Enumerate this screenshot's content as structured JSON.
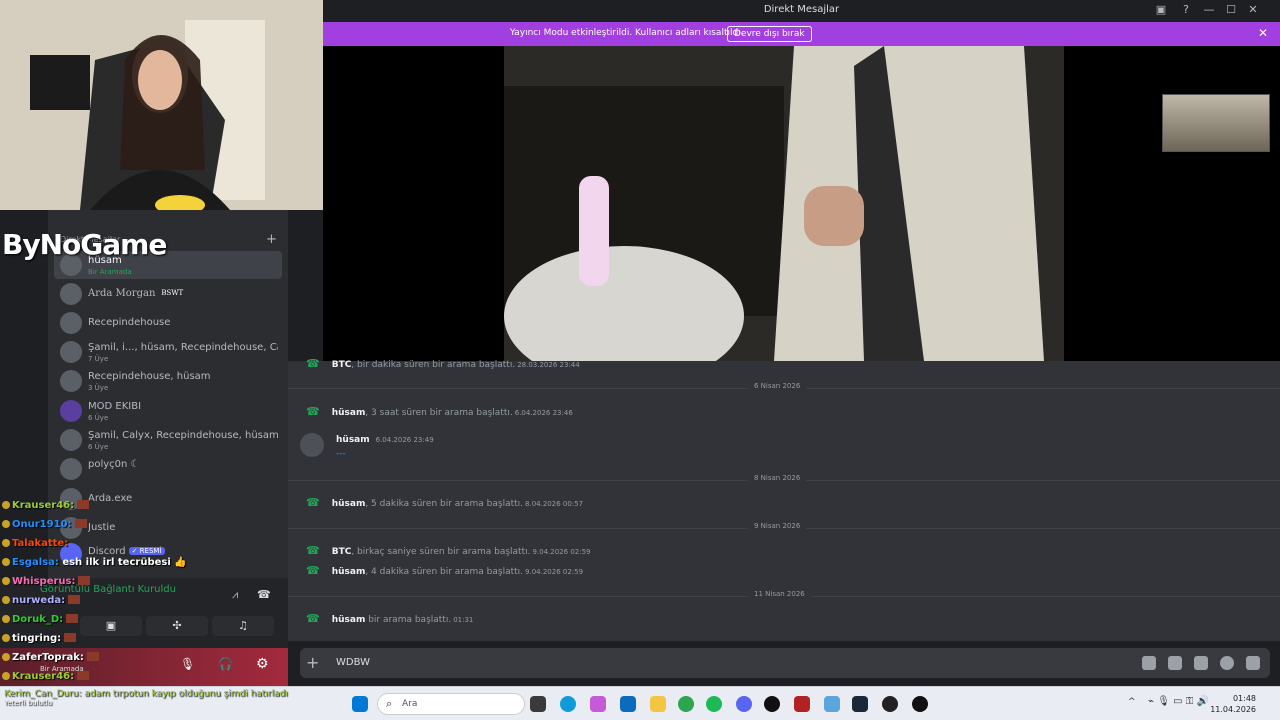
{
  "window": {
    "title": "Direkt Mesajlar",
    "controls": [
      "—",
      "☐",
      "✕"
    ]
  },
  "banner": {
    "message": "Yayıncı Modu etkinleştirildi. Kullanıcı adları kısaltıldı.",
    "button": "Devre dışı bırak"
  },
  "overlay": {
    "logo": "ByNoGame"
  },
  "sidebar": {
    "header": "Direkt Mesajlar",
    "add": "+",
    "dms": [
      {
        "name": "hüsam",
        "sub": "Bir Aramada",
        "active": true
      },
      {
        "name": "Arda Morgan",
        "tag": "BSWT"
      },
      {
        "name": "Recepindehouse",
        "sub": ""
      },
      {
        "name": "Şamil, i..., hüsam, Recepindehouse, Calyx...",
        "sub": "7 Üye"
      },
      {
        "name": "Recepindehouse, hüsam",
        "sub": "3 Üye"
      },
      {
        "name": "MOD EKİBİ",
        "sub": "6 Üye"
      },
      {
        "name": "Şamil, Calyx, Recepindehouse, hüsam, u...",
        "sub": "6 Üye"
      },
      {
        "name": "polyç0n ☾",
        "sub": ""
      },
      {
        "name": "Arda.exe",
        "sub": ""
      },
      {
        "name": "Justie",
        "sub": ""
      },
      {
        "name": "Discord",
        "tag": "✓ RESMİ"
      }
    ]
  },
  "chat": [
    {
      "user": "Krauser46:",
      "color": "#9acd32"
    },
    {
      "user": "Onur1910:",
      "color": "#1e90ff"
    },
    {
      "user": "Talakatte:",
      "color": "#ff4500"
    },
    {
      "user": "Esgalsa:",
      "color": "#1e90ff",
      "text": "esh ilk irl tecrübesi 👍"
    },
    {
      "user": "Whisperus:",
      "color": "#ff69b4"
    },
    {
      "user": "nurweda:",
      "color": "#b0b0ff"
    },
    {
      "user": "Doruk_D:",
      "color": "#32cd32"
    },
    {
      "user": "tingring:",
      "color": "#ffffff"
    },
    {
      "user": "ZaferToprak:",
      "color": "#ffffff"
    },
    {
      "user": "Krauser46:",
      "color": "#9acd32"
    }
  ],
  "voice": {
    "status": "Görüntülü Bağlantı Kuruldu",
    "user_sub": "Bir Aramada"
  },
  "bottom_chat": "Kerim_Can_Duru: adam tırpotun kayıp olduğunu şimdi hatırladı",
  "bottom_chat2": "Yeterli bulutlu",
  "messages": {
    "first": {
      "user": "BTC",
      "text": ", bir dakika süren bir arama başlattı.",
      "ts": "28.03.2026 23:44"
    },
    "sections": [
      {
        "date": "6 Nisan 2026",
        "items": [
          {
            "user": "hüsam",
            "text": ", 3 saat süren bir arama başlattı.",
            "ts": "6.04.2026 23:46"
          },
          {
            "user": "hüsam",
            "text": "",
            "ts": "6.04.2026 23:49",
            "msg": "---"
          }
        ]
      },
      {
        "date": "8 Nisan 2026",
        "items": [
          {
            "user": "hüsam",
            "text": ", 5 dakika süren bir arama başlattı.",
            "ts": "8.04.2026 00:57"
          }
        ]
      },
      {
        "date": "9 Nisan 2026",
        "items": [
          {
            "user": "BTC",
            "text": ", birkaç saniye süren bir arama başlattı.",
            "ts": "9.04.2026 02:59"
          },
          {
            "user": "hüsam",
            "text": ", 4 dakika süren bir arama başlattı.",
            "ts": "9.04.2026 02:59"
          }
        ]
      },
      {
        "date": "11 Nisan 2026",
        "items": [
          {
            "user": "hüsam",
            "text": " bir arama başlattı.",
            "ts": "01:31"
          }
        ]
      }
    ]
  },
  "input": {
    "value": "WDBW"
  },
  "taskbar": {
    "search": "Ara",
    "time": "01:48",
    "date": "11.04.2026"
  },
  "colors": {
    "banner": "#a23fe0",
    "accent": "#5865f2",
    "green": "#23a559"
  }
}
